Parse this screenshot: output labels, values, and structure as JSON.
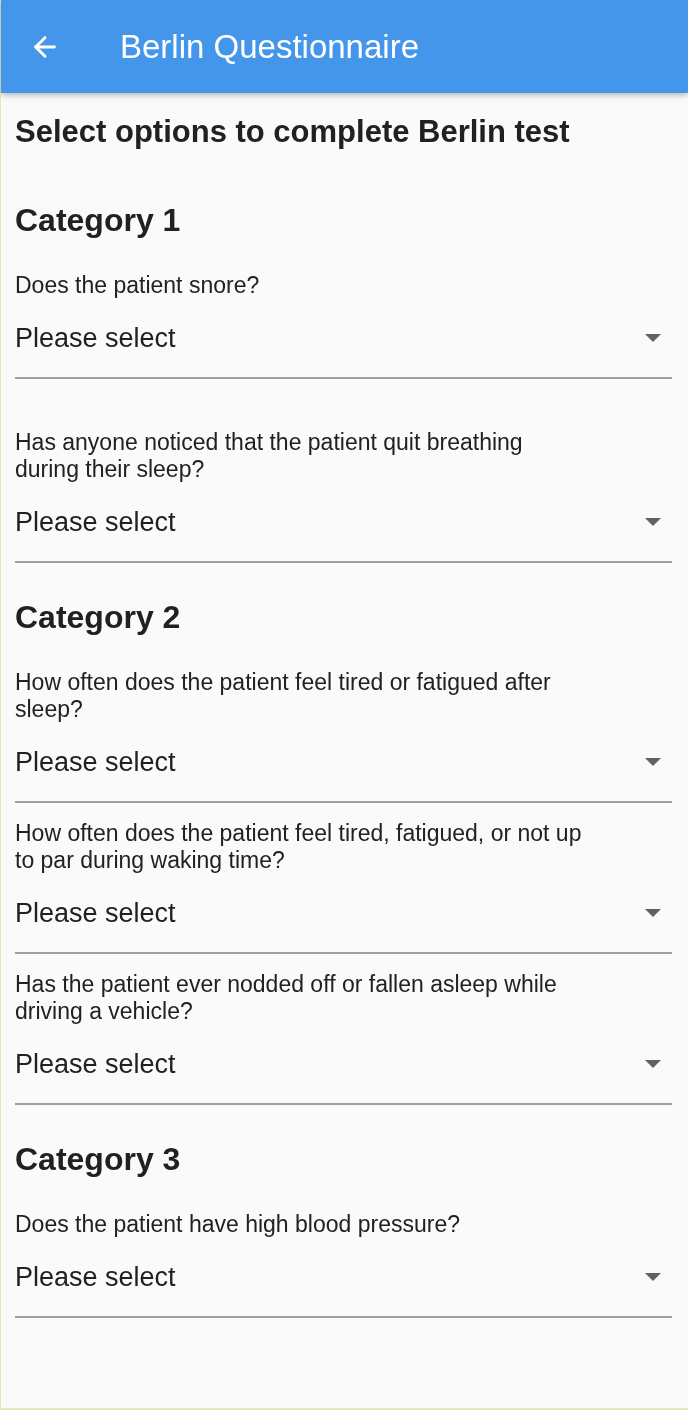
{
  "app_bar": {
    "title": "Berlin Questionnaire"
  },
  "heading": "Select options to complete Berlin test",
  "categories": [
    {
      "title": "Category 1",
      "questions": [
        {
          "label": "Does the patient snore?",
          "placeholder": "Please select"
        },
        {
          "label": "Has anyone noticed that the patient quit breathing during their sleep?",
          "placeholder": "Please select"
        }
      ]
    },
    {
      "title": "Category 2",
      "questions": [
        {
          "label": "How often does the patient feel tired or fatigued after sleep?",
          "placeholder": "Please select"
        },
        {
          "label": "How often does the patient feel tired, fatigued, or not up to par during waking time?",
          "placeholder": "Please select"
        },
        {
          "label": "Has the patient ever nodded off or fallen asleep while driving a vehicle?",
          "placeholder": "Please select"
        }
      ]
    },
    {
      "title": "Category 3",
      "questions": [
        {
          "label": "Does the patient have high blood pressure?",
          "placeholder": "Please select"
        }
      ]
    }
  ]
}
